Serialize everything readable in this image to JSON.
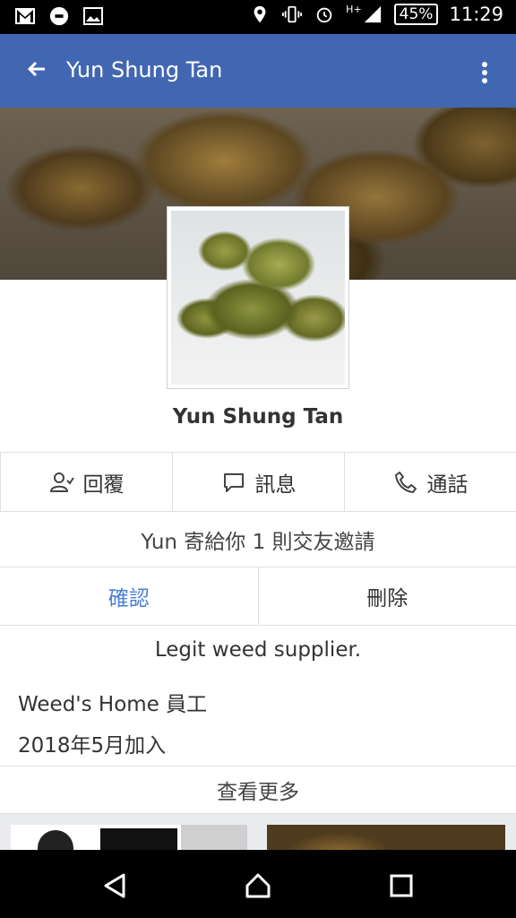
{
  "status_bar": {
    "battery": "45%",
    "time": "11:29",
    "network": "H+",
    "icons": [
      "gmail-icon",
      "uber-icon",
      "image-icon",
      "location-icon",
      "vibrate-icon",
      "alarm-icon",
      "signal-icon",
      "battery-icon"
    ]
  },
  "app_bar": {
    "title": "Yun Shung Tan",
    "back_icon": "arrow-left-icon",
    "more_icon": "more-vert-icon",
    "color": "#4267b2"
  },
  "profile": {
    "name": "Yun Shung Tan"
  },
  "actions": {
    "respond": "回覆",
    "message": "訊息",
    "call": "通話"
  },
  "friend_request": {
    "text": "Yun 寄給你 1 則交友邀請",
    "confirm": "確認",
    "delete": "刪除",
    "confirm_color": "#4a7fd4"
  },
  "bio": "Legit weed supplier.",
  "details": {
    "work": "Weed's Home 員工",
    "joined": "2018年5月加入"
  },
  "see_more": "查看更多",
  "nav": {
    "icons": [
      "back-triangle-icon",
      "home-icon",
      "recents-icon"
    ]
  }
}
